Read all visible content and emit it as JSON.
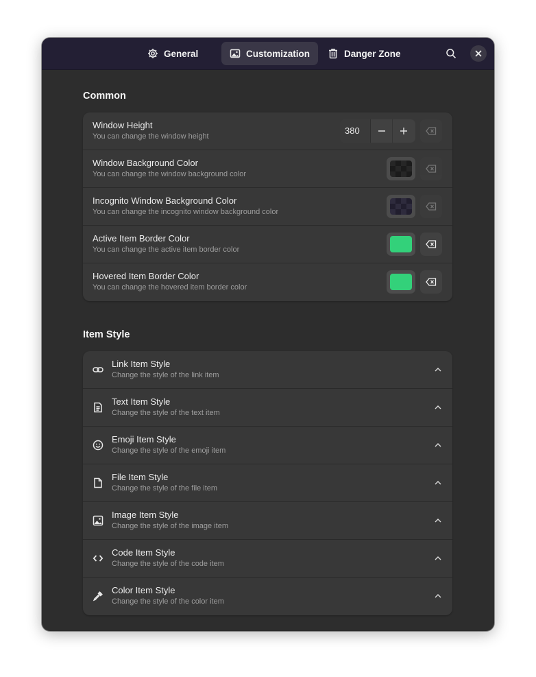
{
  "tabs": [
    {
      "label": "General",
      "icon": "gear-icon",
      "active": false
    },
    {
      "label": "Customization",
      "icon": "image-icon",
      "active": true
    },
    {
      "label": "Danger Zone",
      "icon": "trash-icon",
      "active": false
    }
  ],
  "sections": {
    "common": {
      "title": "Common",
      "rows": [
        {
          "title": "Window Height",
          "subtitle": "You can change the window height",
          "value": "380"
        },
        {
          "title": "Window Background Color",
          "subtitle": "You can change the window background color"
        },
        {
          "title": "Incognito Window Background Color",
          "subtitle": "You can change the incognito window background color"
        },
        {
          "title": "Active Item Border Color",
          "subtitle": "You can change the active item border color",
          "color": "#33d17a"
        },
        {
          "title": "Hovered Item Border Color",
          "subtitle": "You can change the hovered item border color",
          "color": "#33d17a"
        }
      ]
    },
    "item_style": {
      "title": "Item Style",
      "rows": [
        {
          "title": "Link Item Style",
          "subtitle": "Change the style of the link item",
          "icon": "link-icon"
        },
        {
          "title": "Text Item Style",
          "subtitle": "Change the style of the text item",
          "icon": "document-icon"
        },
        {
          "title": "Emoji Item Style",
          "subtitle": "Change the style of the emoji item",
          "icon": "emoji-icon"
        },
        {
          "title": "File Item Style",
          "subtitle": "Change the style of the file item",
          "icon": "file-icon"
        },
        {
          "title": "Image Item Style",
          "subtitle": "Change the style of the image item",
          "icon": "image-icon"
        },
        {
          "title": "Code Item Style",
          "subtitle": "Change the style of the code item",
          "icon": "code-icon"
        },
        {
          "title": "Color Item Style",
          "subtitle": "Change the style of the color item",
          "icon": "color-picker-icon"
        }
      ]
    }
  },
  "colors": {
    "headerbar": "#231f34",
    "window_bg": "#2d2d2d",
    "card_bg": "#383838",
    "accent_green": "#33d17a"
  }
}
